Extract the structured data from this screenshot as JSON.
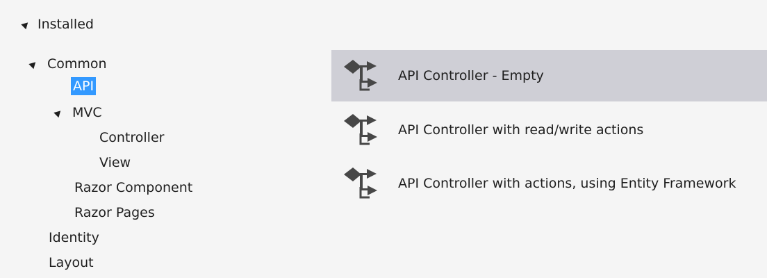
{
  "tree": {
    "root_label": "Installed",
    "items": [
      {
        "label": "Common",
        "expander": true
      },
      {
        "label": "API",
        "selected": true
      },
      {
        "label": "MVC",
        "expander": true
      },
      {
        "label": "Controller"
      },
      {
        "label": "View"
      },
      {
        "label": "Razor Component"
      },
      {
        "label": "Razor Pages"
      },
      {
        "label": "Identity"
      },
      {
        "label": "Layout"
      }
    ]
  },
  "templates": [
    {
      "label": "API Controller - Empty",
      "icon": "api-controller-icon",
      "selected": true
    },
    {
      "label": "API Controller with read/write actions",
      "icon": "api-controller-icon"
    },
    {
      "label": "API Controller with actions, using Entity Framework",
      "icon": "api-controller-icon"
    }
  ],
  "colors": {
    "background": "#f5f5f5",
    "selected_tree_item": "#3399ff",
    "selected_template": "#cfcfd6",
    "text": "#1e1e1e"
  }
}
